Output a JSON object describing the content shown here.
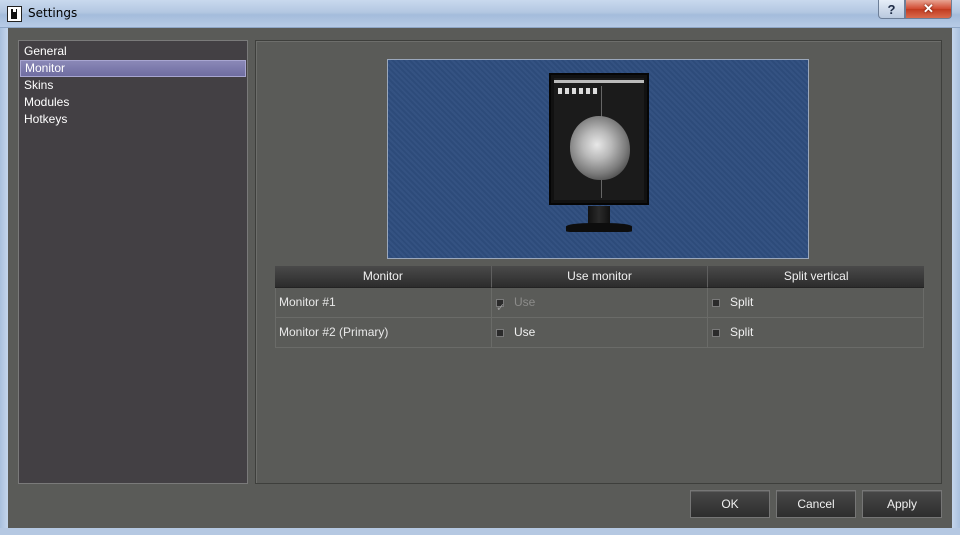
{
  "window": {
    "title": "Settings",
    "help_label": "?",
    "close_label": "✕"
  },
  "sidebar": {
    "items": [
      {
        "label": "General",
        "selected": false
      },
      {
        "label": "Monitor",
        "selected": true
      },
      {
        "label": "Skins",
        "selected": false
      },
      {
        "label": "Modules",
        "selected": false
      },
      {
        "label": "Hotkeys",
        "selected": false
      }
    ]
  },
  "table": {
    "headers": [
      "Monitor",
      "Use monitor",
      "Split vertical"
    ],
    "rows": [
      {
        "name": "Monitor #1",
        "use_label": "Use",
        "use_checked": true,
        "use_enabled": false,
        "split_label": "Split",
        "split_checked": false
      },
      {
        "name": "Monitor #2 (Primary)",
        "use_label": "Use",
        "use_checked": false,
        "use_enabled": true,
        "split_label": "Split",
        "split_checked": false
      }
    ]
  },
  "buttons": {
    "ok": "OK",
    "cancel": "Cancel",
    "apply": "Apply"
  },
  "colors": {
    "background": "#5a5b58",
    "sidebar": "#434044",
    "selection": "#7b79ad",
    "preview": "#2e4d7e"
  }
}
